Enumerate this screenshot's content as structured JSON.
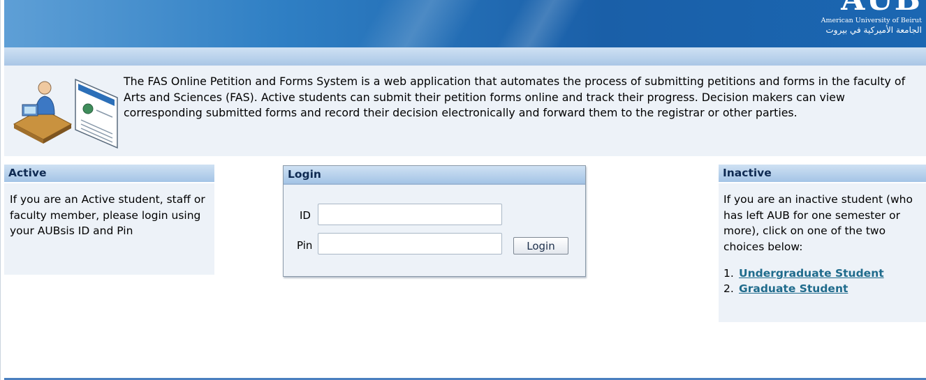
{
  "banner": {
    "logo_mark": "AUB",
    "logo_en": "American University of Beirut",
    "logo_ar": "الجامعة الأميركية في بيروت"
  },
  "intro": {
    "text": "The FAS Online Petition and Forms System is a web application that automates the process of submitting petitions and forms in the faculty of Arts and Sciences (FAS). Active students can submit their petition forms online and track their progress. Decision makers can view corresponding submitted forms and record their decision electronically and forward them to the registrar or other parties."
  },
  "active": {
    "title": "Active",
    "text": "If you are an Active student, staff or faculty member, please login using your AUBsis ID and Pin"
  },
  "login": {
    "title": "Login",
    "id_label": "ID",
    "id_value": "",
    "pin_label": "Pin",
    "pin_value": "",
    "button_label": "Login"
  },
  "inactive": {
    "title": "Inactive",
    "text": "If you are an inactive student (who has left AUB for one semester or more), click on one of the two choices below:",
    "choices": [
      {
        "num": "1.",
        "label": "Undergraduate Student"
      },
      {
        "num": "2.",
        "label": "Graduate Student"
      }
    ]
  },
  "colors": {
    "banner": "#1a5fa8",
    "panel_bg": "#edf2f8",
    "header_bg": "#a4c4e6",
    "link": "#1f6b8c"
  }
}
